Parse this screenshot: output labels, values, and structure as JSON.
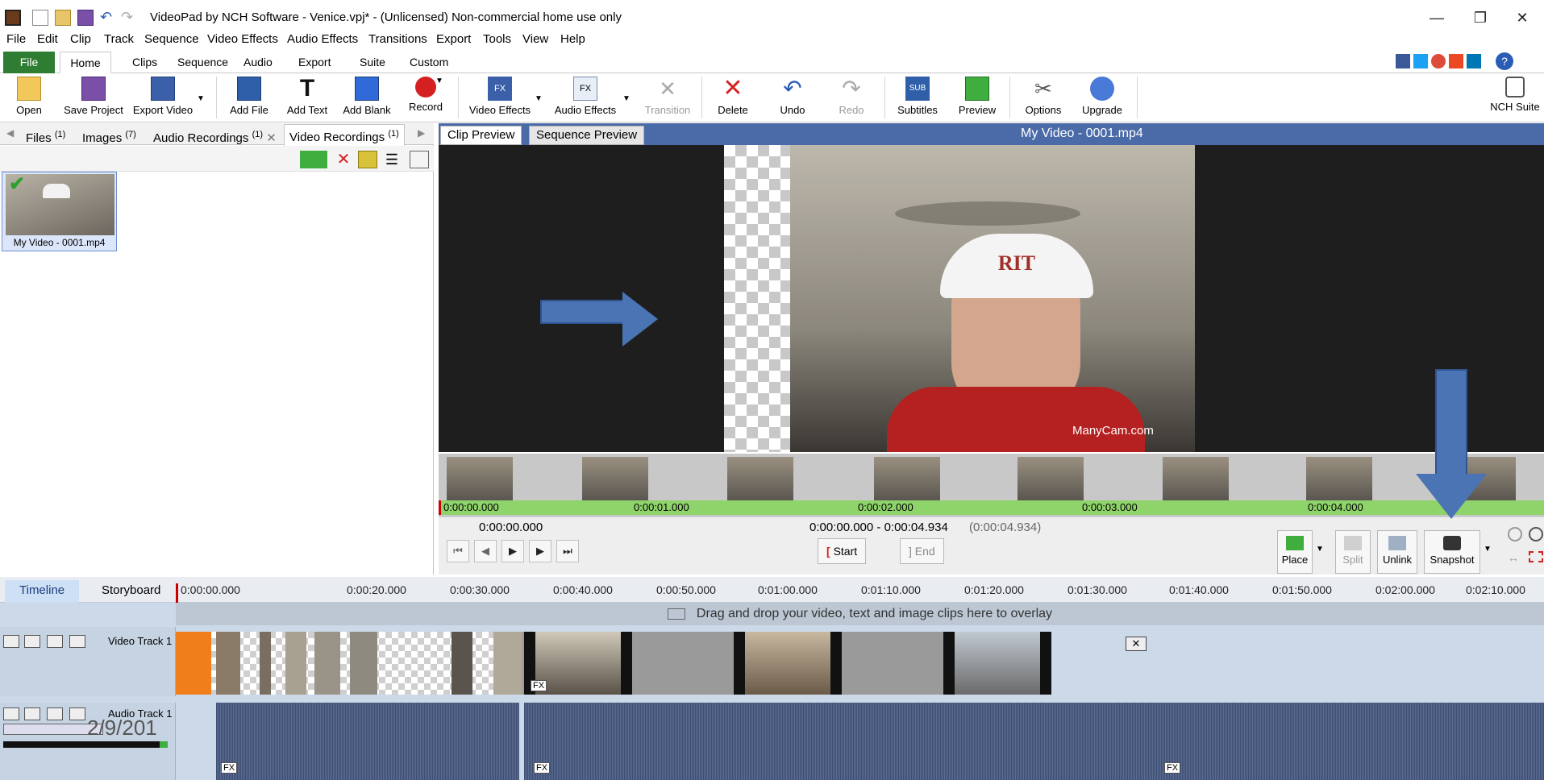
{
  "window": {
    "title": "VideoPad by NCH Software - Venice.vpj* - (Unlicensed) Non-commercial home use only",
    "minimize": "—",
    "restore": "❐",
    "close": "✕"
  },
  "menu": [
    "File",
    "Edit",
    "Clip",
    "Track",
    "Sequence",
    "Video Effects",
    "Audio Effects",
    "Transitions",
    "Export",
    "Tools",
    "View",
    "Help"
  ],
  "ribbon_tabs": [
    "File",
    "Home",
    "Clips",
    "Sequence",
    "Audio",
    "Export",
    "Suite",
    "Custom"
  ],
  "ribbon": {
    "open": "Open",
    "save_project": "Save Project",
    "export_video": "Export Video",
    "add_file": "Add File",
    "add_text": "Add Text",
    "add_blank": "Add Blank",
    "record": "Record",
    "video_effects": "Video Effects",
    "audio_effects": "Audio Effects",
    "transition": "Transition",
    "delete": "Delete",
    "undo": "Undo",
    "redo": "Redo",
    "subtitles": "Subtitles",
    "preview": "Preview",
    "options": "Options",
    "upgrade": "Upgrade",
    "nch_suite": "NCH Suite"
  },
  "bins": {
    "tabs": [
      {
        "label": "Files",
        "count": "(1)"
      },
      {
        "label": "Images",
        "count": "(7)"
      },
      {
        "label": "Audio Recordings",
        "count": "(1)"
      },
      {
        "label": "Video Recordings",
        "count": "(1)"
      }
    ],
    "clip_name": "My Video - 0001.mp4"
  },
  "preview": {
    "tab_clip": "Clip Preview",
    "tab_sequence": "Sequence Preview",
    "title": "My Video - 0001.mp4",
    "watermark": "ManyCam.com",
    "cap_text": "RIT",
    "ruler": [
      "0:00:00.000",
      "0:00:01.000",
      "0:00:02.000",
      "0:00:03.000",
      "0:00:04.000"
    ],
    "current_time": "0:00:00.000",
    "range": "0:00:00.000 - 0:00:04.934",
    "duration": "(0:00:04.934)",
    "start_label": "Start",
    "end_label": "End",
    "place": "Place",
    "split": "Split",
    "unlink": "Unlink",
    "snapshot": "Snapshot"
  },
  "timeline": {
    "tab_timeline": "Timeline",
    "tab_storyboard": "Storyboard",
    "ruler": [
      "0:00:00.000",
      "0:00:20.000",
      "0:00:30.000",
      "0:00:40.000",
      "0:00:50.000",
      "0:01:00.000",
      "0:01:10.000",
      "0:01:20.000",
      "0:01:30.000",
      "0:01:40.000",
      "0:01:50.000",
      "0:02:00.000",
      "0:02:10.000"
    ],
    "overlay_hint": "Drag and drop your video, text and image clips here to overlay",
    "video_track": "Video Track 1",
    "audio_track": "Audio Track 1",
    "date_stamp": "2/9/201",
    "fx": "FX"
  },
  "colors": {
    "file_tab": "#2e7d32",
    "preview_header": "#4a6aa8",
    "ruler_green": "#8fd36b",
    "arrow_blue": "#4a74b4"
  }
}
